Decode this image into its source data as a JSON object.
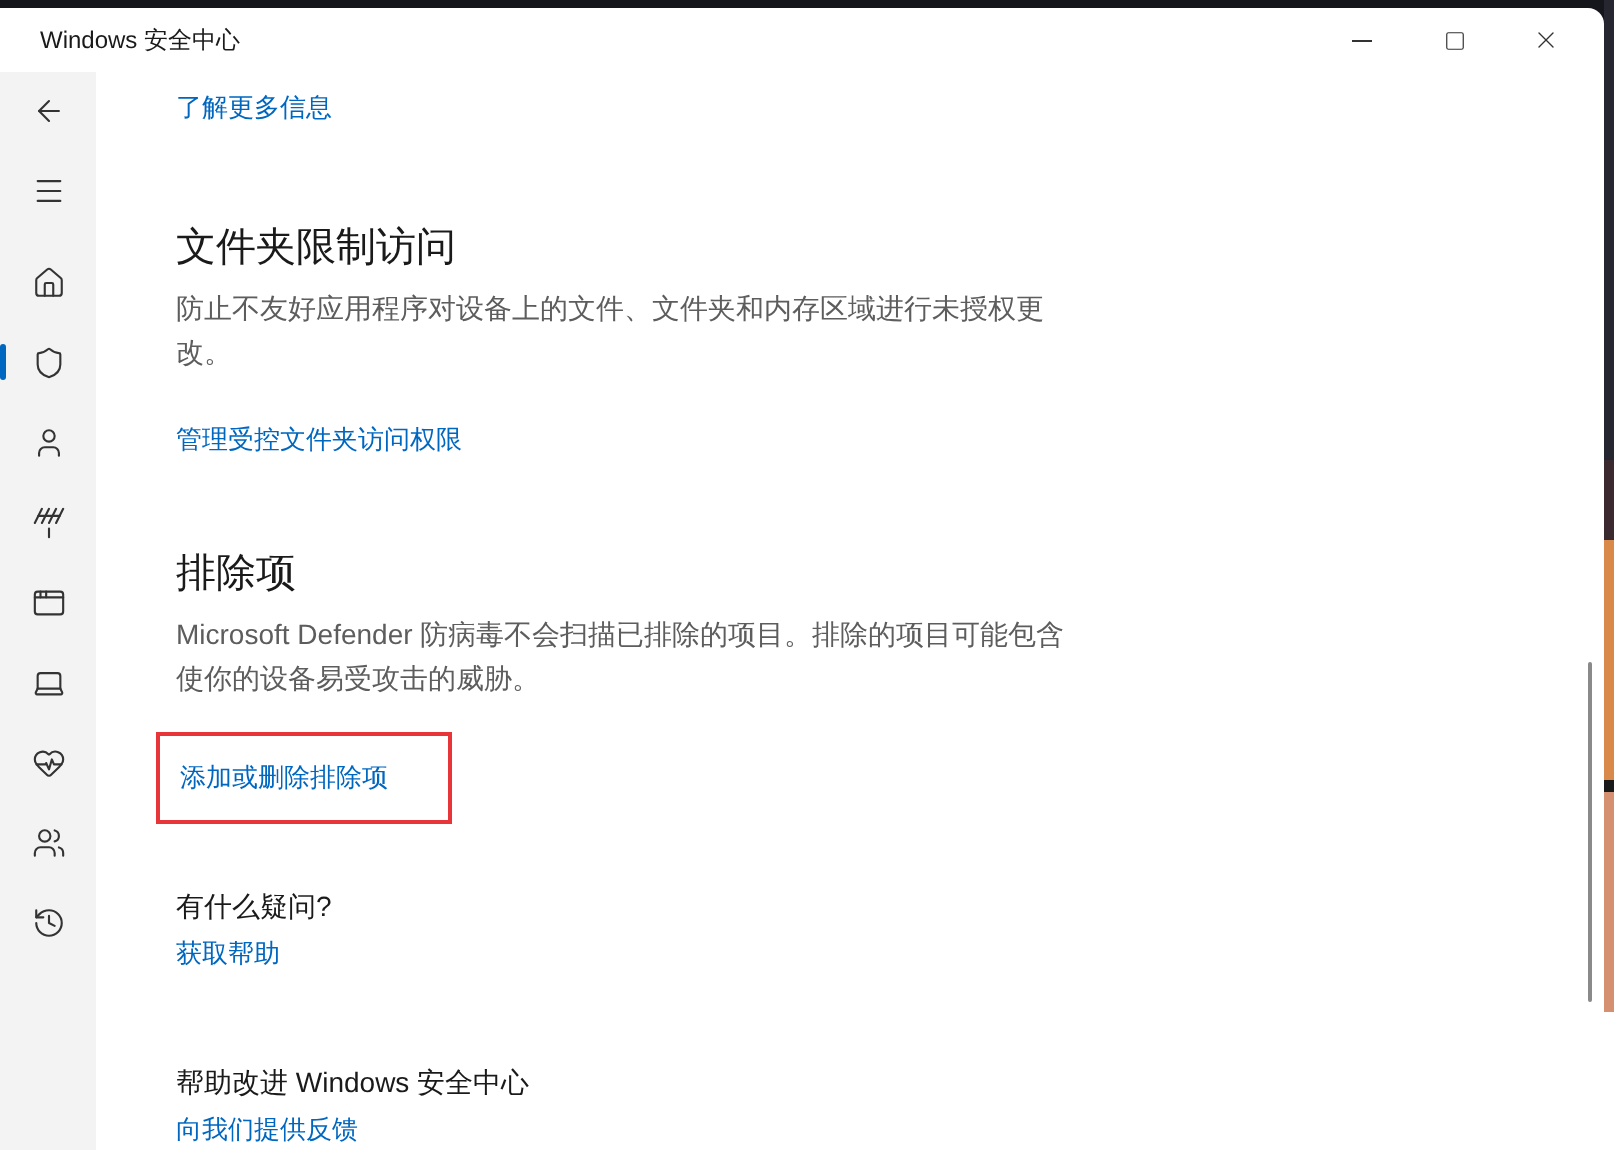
{
  "window": {
    "title": "Windows 安全中心",
    "controls": [
      {
        "kind": "minimize"
      },
      {
        "kind": "maximize"
      },
      {
        "kind": "close"
      }
    ]
  },
  "nav": {
    "items": [
      {
        "kind": "back",
        "selected": false
      },
      {
        "kind": "menu",
        "selected": false
      },
      {
        "kind": "home",
        "selected": false
      },
      {
        "kind": "shield",
        "selected": true
      },
      {
        "kind": "account",
        "selected": false
      },
      {
        "kind": "network",
        "selected": false
      },
      {
        "kind": "app",
        "selected": false
      },
      {
        "kind": "device",
        "selected": false
      },
      {
        "kind": "health",
        "selected": false
      },
      {
        "kind": "family",
        "selected": false
      },
      {
        "kind": "history",
        "selected": false
      }
    ]
  },
  "content": {
    "top_link": "了解更多信息",
    "sections": [
      {
        "heading": "文件夹限制访问",
        "description": "防止不友好应用程序对设备上的文件、文件夹和内存区域进行未授权更改。",
        "link": "管理受控文件夹访问权限",
        "highlighted": false
      },
      {
        "heading": "排除项",
        "description": "Microsoft Defender 防病毒不会扫描已排除的项目。排除的项目可能包含使你的设备易受攻击的威胁。",
        "link": "添加或删除排除项",
        "highlighted": true
      }
    ],
    "help": [
      {
        "title": "有什么疑问?",
        "link": "获取帮助"
      },
      {
        "title": "帮助改进 Windows 安全中心",
        "link": "向我们提供反馈"
      }
    ]
  }
}
